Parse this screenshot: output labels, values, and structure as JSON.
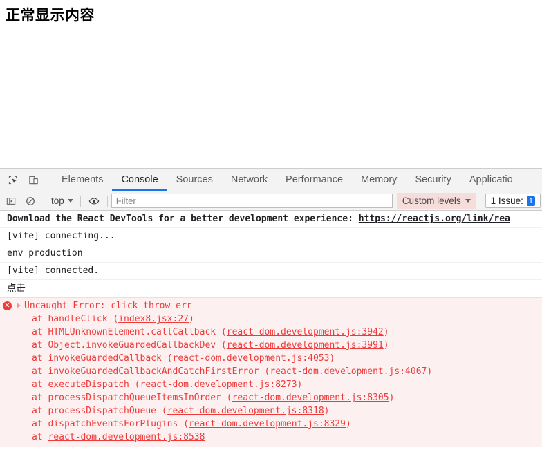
{
  "page": {
    "heading": "正常显示内容"
  },
  "devtools": {
    "toolbar_icons": {
      "inspect": "inspect-element-icon",
      "device": "device-toolbar-icon"
    },
    "tabs": [
      {
        "label": "Elements",
        "active": false
      },
      {
        "label": "Console",
        "active": true
      },
      {
        "label": "Sources",
        "active": false
      },
      {
        "label": "Network",
        "active": false
      },
      {
        "label": "Performance",
        "active": false
      },
      {
        "label": "Memory",
        "active": false
      },
      {
        "label": "Security",
        "active": false
      },
      {
        "label": "Applicatio",
        "active": false
      }
    ],
    "console_toolbar": {
      "sidebar_icon": "console-sidebar-icon",
      "clear_icon": "clear-console-icon",
      "eye_icon": "eye-icon",
      "context": "top",
      "filter_placeholder": "Filter",
      "filter_value": "",
      "levels_label": "Custom levels",
      "issues_label": "1 Issue:",
      "issues_badge": "1"
    },
    "messages": [
      {
        "type": "info-bold",
        "text": "Download the React DevTools for a better development experience: ",
        "link": "https://reactjs.org/link/rea"
      },
      {
        "type": "log",
        "text": "[vite] connecting..."
      },
      {
        "type": "log",
        "text": "env production"
      },
      {
        "type": "log",
        "text": "[vite] connected."
      },
      {
        "type": "log-cjk",
        "text": "点击"
      }
    ],
    "error": {
      "icon": "error-circle-icon",
      "icon_glyph": "✕",
      "title": "Uncaught Error: click throw err",
      "frames": [
        {
          "fn": "at handleClick (",
          "link": "index8.jsx:27",
          "tail": ")"
        },
        {
          "fn": "at HTMLUnknownElement.callCallback (",
          "link": "react-dom.development.js:3942",
          "tail": ")"
        },
        {
          "fn": "at Object.invokeGuardedCallbackDev (",
          "link": "react-dom.development.js:3991",
          "tail": ")"
        },
        {
          "fn": "at invokeGuardedCallback (",
          "link": "react-dom.development.js:4053",
          "tail": ")"
        },
        {
          "fn": "at invokeGuardedCallbackAndCatchFirstError (",
          "link": "react-dom.development.js:4067",
          "tail": ")",
          "nolink": true
        },
        {
          "fn": "at executeDispatch (",
          "link": "react-dom.development.js:8273",
          "tail": ")"
        },
        {
          "fn": "at processDispatchQueueItemsInOrder (",
          "link": "react-dom.development.js:8305",
          "tail": ")"
        },
        {
          "fn": "at processDispatchQueue (",
          "link": "react-dom.development.js:8318",
          "tail": ")"
        },
        {
          "fn": "at dispatchEventsForPlugins (",
          "link": "react-dom.development.js:8329",
          "tail": ")"
        },
        {
          "fn": "at ",
          "link": "react-dom.development.js:8538",
          "tail": ""
        }
      ]
    }
  },
  "colors": {
    "accent": "#1a73e8",
    "error": "#ef3a3a",
    "error_bg": "#fdf0f0",
    "toolbar_bg": "#f3f3f3",
    "levels_bg": "#f7dcdc"
  }
}
